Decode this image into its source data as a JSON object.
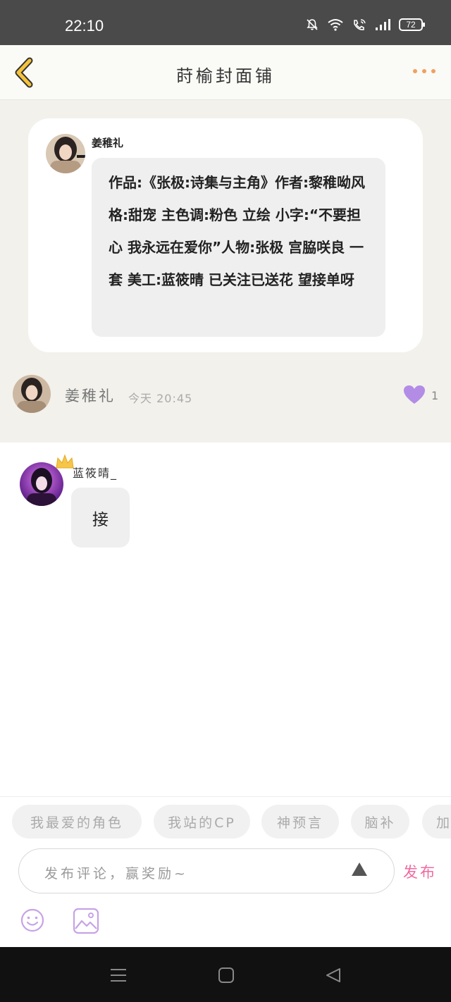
{
  "status_bar": {
    "time": "22:10",
    "battery": "72",
    "icons": [
      "bell-off-icon",
      "wifi-icon",
      "phone-wifi-icon",
      "signal-icon",
      "battery-icon"
    ]
  },
  "nav": {
    "title": "莳榆封面铺",
    "back_icon": "chevron-left-icon",
    "more_icon": "more-dots-icon",
    "accent_color": "#f5c33b",
    "more_color": "#f0a060"
  },
  "post_card": {
    "name": "姜稚礼",
    "text": "作品:《张极:诗集与主角》作者:黎稚呦风格:甜宠 主色调:粉色 立绘 小字:“不要担心 我永远在爱你”人物:张极 宫脇咲良 一套 美工:蓝筱晴 已关注已送花 望接单呀"
  },
  "author_row": {
    "name": "姜稚礼",
    "time": "今天 20:45",
    "likes": "1",
    "like_icon": "heart-icon",
    "like_color": "#b38ce6"
  },
  "comment": {
    "name": "蓝筱晴_",
    "text": "接",
    "crown_icon": "crown-icon"
  },
  "tags": [
    "我最爱的角色",
    "我站的CP",
    "神预言",
    "脑补",
    "加"
  ],
  "composer": {
    "placeholder": "发布评论，赢奖励~",
    "publish_label": "发布",
    "publish_color": "#f06aa0",
    "send_icon": "triangle-send-icon",
    "emoji_icon": "smiley-icon",
    "image_icon": "image-icon",
    "tool_color": "#c7a3e6"
  },
  "system_nav": {
    "icons": [
      "menu-icon",
      "home-square-icon",
      "back-triangle-icon"
    ]
  }
}
